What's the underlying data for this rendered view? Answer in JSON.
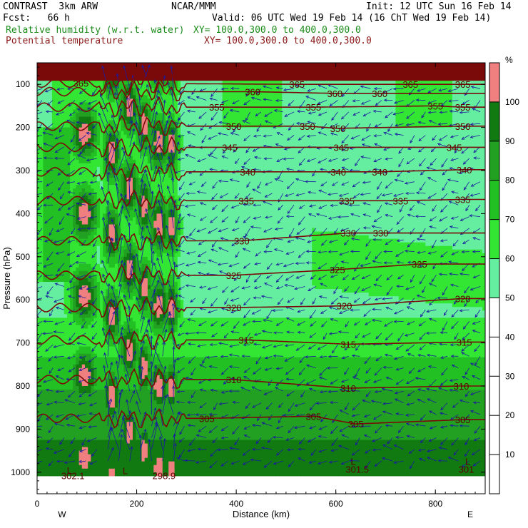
{
  "header": {
    "model": "CONTRAST  3km ARW",
    "org": "NCAR/MMM",
    "init": "Init: 12 UTC Sun 16 Feb 14",
    "fcst": "Fcst:   66 h",
    "valid": "Valid: 06 UTC Wed 19 Feb 14 (16 ChT Wed 19 Feb 14)",
    "field1": "Relative humidity (w.r.t. water)",
    "field1_xy": "XY= 100.0,300.0 to 400.0,300.0",
    "field2": "Potential temperature",
    "field2_xy": "XY= 100.0,300.0 to 400.0,300.0"
  },
  "colors": {
    "rh_levels": [
      "#ffffff",
      "#ffffff",
      "#ffffff",
      "#ffffff",
      "#ffffff",
      "#66eea0",
      "#33e633",
      "#22c022",
      "#118f11",
      "#f08080",
      "#7a0a0a"
    ],
    "theta": "#7a0a0a",
    "wind": "#1a1aa0"
  },
  "chart_data": {
    "type": "heatmap",
    "title": "Relative humidity (w.r.t. water) and Potential temperature cross section",
    "xlabel": "Distance (km)",
    "ylabel": "Pressure (hPa)",
    "x_ticks": [
      0,
      200,
      400,
      600,
      800
    ],
    "y_ticks": [
      100,
      200,
      300,
      400,
      500,
      600,
      700,
      800,
      900,
      1000
    ],
    "xlim": [
      0,
      900
    ],
    "ylim": [
      1050,
      50
    ],
    "x_end_labels": {
      "left": "W",
      "right": "E"
    },
    "colorbar": {
      "unit": "%",
      "ticks": [
        10,
        20,
        30,
        40,
        50,
        60,
        70,
        80,
        90,
        100
      ],
      "bins": [
        {
          "range": [
            0,
            50
          ],
          "color": "#ffffff"
        },
        {
          "range": [
            50,
            60
          ],
          "color": "#66eea0"
        },
        {
          "range": [
            60,
            70
          ],
          "color": "#33e633"
        },
        {
          "range": [
            70,
            80
          ],
          "color": "#22c022"
        },
        {
          "range": [
            80,
            90
          ],
          "color": "#22a022"
        },
        {
          "range": [
            90,
            100
          ],
          "color": "#117a11"
        },
        {
          "range": [
            100,
            110
          ],
          "color": "#f08080"
        }
      ]
    },
    "theta_contours": [
      {
        "value": 305,
        "labels": [
          {
            "x": 341,
            "p": 875
          },
          {
            "x": 555,
            "p": 870
          },
          {
            "x": 640,
            "p": 888
          },
          {
            "x": 855,
            "p": 878
          }
        ]
      },
      {
        "value": 310,
        "labels": [
          {
            "x": 395,
            "p": 785
          },
          {
            "x": 625,
            "p": 805
          },
          {
            "x": 852,
            "p": 800
          }
        ]
      },
      {
        "value": 315,
        "labels": [
          {
            "x": 420,
            "p": 693
          },
          {
            "x": 625,
            "p": 703
          },
          {
            "x": 858,
            "p": 698
          }
        ]
      },
      {
        "value": 320,
        "labels": [
          {
            "x": 395,
            "p": 618
          },
          {
            "x": 617,
            "p": 614
          },
          {
            "x": 855,
            "p": 597
          }
        ]
      },
      {
        "value": 325,
        "labels": [
          {
            "x": 395,
            "p": 543
          },
          {
            "x": 603,
            "p": 530
          },
          {
            "x": 768,
            "p": 517
          }
        ]
      },
      {
        "value": 330,
        "labels": [
          {
            "x": 411,
            "p": 463
          },
          {
            "x": 625,
            "p": 445
          },
          {
            "x": 690,
            "p": 445
          }
        ]
      },
      {
        "value": 335,
        "labels": [
          {
            "x": 420,
            "p": 370
          },
          {
            "x": 622,
            "p": 370
          },
          {
            "x": 730,
            "p": 370
          },
          {
            "x": 855,
            "p": 367
          }
        ]
      },
      {
        "value": 340,
        "labels": [
          {
            "x": 423,
            "p": 303
          },
          {
            "x": 605,
            "p": 303
          },
          {
            "x": 688,
            "p": 303
          },
          {
            "x": 858,
            "p": 298
          }
        ]
      },
      {
        "value": 345,
        "labels": [
          {
            "x": 387,
            "p": 246
          },
          {
            "x": 611,
            "p": 246
          },
          {
            "x": 838,
            "p": 246
          }
        ]
      },
      {
        "value": 350,
        "labels": [
          {
            "x": 395,
            "p": 197
          },
          {
            "x": 543,
            "p": 197
          },
          {
            "x": 604,
            "p": 202
          },
          {
            "x": 855,
            "p": 197
          }
        ]
      },
      {
        "value": 355,
        "labels": [
          {
            "x": 361,
            "p": 153
          },
          {
            "x": 555,
            "p": 153
          },
          {
            "x": 800,
            "p": 150
          },
          {
            "x": 855,
            "p": 153
          }
        ]
      },
      {
        "value": 360,
        "labels": [
          {
            "x": 433,
            "p": 117
          },
          {
            "x": 598,
            "p": 121
          },
          {
            "x": 688,
            "p": 121
          }
        ]
      },
      {
        "value": 365,
        "labels": [
          {
            "x": 88,
            "p": 97
          },
          {
            "x": 522,
            "p": 100
          },
          {
            "x": 750,
            "p": 100
          },
          {
            "x": 855,
            "p": 100
          }
        ]
      }
    ],
    "surface_labels": [
      {
        "text": "302.1",
        "x": 72,
        "p": 1008
      },
      {
        "text": "298.9",
        "x": 255,
        "p": 1008
      },
      {
        "text": "301.5",
        "x": 643,
        "p": 993
      },
      {
        "text": "301",
        "x": 862,
        "p": 993
      }
    ],
    "low_labels": [
      {
        "text": "L",
        "x": 65,
        "p": 995
      },
      {
        "text": "L",
        "x": 177,
        "p": 996
      },
      {
        "text": "L",
        "x": 635,
        "p": 975
      },
      {
        "text": "L",
        "x": 865,
        "p": 975
      }
    ]
  }
}
